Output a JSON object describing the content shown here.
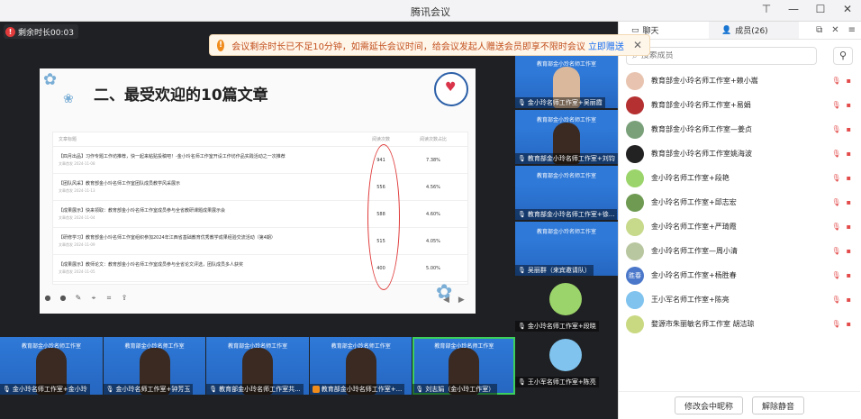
{
  "window": {
    "title": "腾讯会议"
  },
  "timer": {
    "label": "剩余时长00:03"
  },
  "notice": {
    "text": "会议剩余时长已不足10分钟，如需延长会议时间，给会议发起人赠送会员即享不限时会议",
    "link": "立即赠送"
  },
  "slide": {
    "title": "二、最受欢迎的10篇文章",
    "columns": [
      "文章标题",
      "阅读次数",
      "阅读次数占比"
    ],
    "rows": [
      {
        "title": "【四月出品】习作专题工作坊推荐，快一起来粘贴投稿吧！-金小玲名师工作室开设工作坊作品实践活动之一次推荐",
        "date": "文章首发  2024-11-08",
        "reads": "941",
        "ratio": "7.38%"
      },
      {
        "title": "【团队风采】教育部金小玲名师工作室团队成员教学风采展示",
        "date": "文章首发  2024-11-13",
        "reads": "556",
        "ratio": "4.56%"
      },
      {
        "title": "【成果展示】快来领取：教育部金小玲名师工作室成员参与全省教研课题成果展示会",
        "date": "文章首发  2024-11-04",
        "reads": "588",
        "ratio": "4.60%"
      },
      {
        "title": "【研修学习】教育部金小玲名师工作室组织参加2024年江西省基础教育优秀教学成果经验交流活动（第4期）",
        "date": "文章首发  2024-11-09",
        "reads": "515",
        "ratio": "4.05%"
      },
      {
        "title": "【成果展示】教师论文：教育部金小玲名师工作室成员参与全省论文评选，团队成员多人获奖",
        "date": "文章首发  2024-11-05",
        "reads": "400",
        "ratio": "5.00%"
      }
    ]
  },
  "side_videos": [
    {
      "banner": "教育部金小玲名师工作室",
      "name": "金小玲名师工作室+吴丽霞"
    },
    {
      "banner": "教育部金小玲名师工作室",
      "name": "教育部金小玲名师工作室+刘钧"
    },
    {
      "banner": "教育部金小玲名师工作室",
      "name": "教育部金小玲名师工作室+徐..."
    },
    {
      "banner": "教育部金小玲名师工作室",
      "name": "吴丽群（来宾邀请队）"
    },
    {
      "banner": "",
      "name": "金小玲名师工作室+段晓"
    },
    {
      "banner": "",
      "name": "王小军名师工作室+陈亮"
    }
  ],
  "bottom_videos": [
    {
      "banner": "教育部金小玲名师工作室",
      "name": "金小玲名师工作室+金小玲"
    },
    {
      "banner": "教育部金小玲名师工作室",
      "name": "金小玲名师工作室+钟芳玉"
    },
    {
      "banner": "教育部金小玲名师工作室",
      "name": "教育部金小玲名师工作室共..."
    },
    {
      "banner": "教育部金小玲名师工作室",
      "name": "教育部金小玲名师工作室+..."
    },
    {
      "banner": "教育部金小玲名师工作室",
      "name": "刘志娟（金小玲工作室）"
    }
  ],
  "panel": {
    "tab_chat": "聊天",
    "tab_members": "成员(26)",
    "search_placeholder": "搜索成员",
    "members": [
      {
        "name": "教育部金小玲名师工作室+赖小嵩"
      },
      {
        "name": "教育部金小玲名师工作室+易娟"
      },
      {
        "name": "教育部金小玲名师工作室—姜贞"
      },
      {
        "name": "教育部金小玲名师工作室姚海波"
      },
      {
        "name": "金小玲名师工作室+段艳"
      },
      {
        "name": "金小玲名师工作室+邱志宏"
      },
      {
        "name": "金小玲名师工作室+严琦霞"
      },
      {
        "name": "金小玲名师工作室—周小清"
      },
      {
        "name": "金小玲名师工作室+杨胜春",
        "avatar_text": "胜春"
      },
      {
        "name": "王小军名师工作室+陈亮"
      },
      {
        "name": "婺源市朱丽敏名师工作室 胡洁琼"
      }
    ],
    "btn_rename": "修改会中昵称",
    "btn_unmute": "解除静音"
  }
}
